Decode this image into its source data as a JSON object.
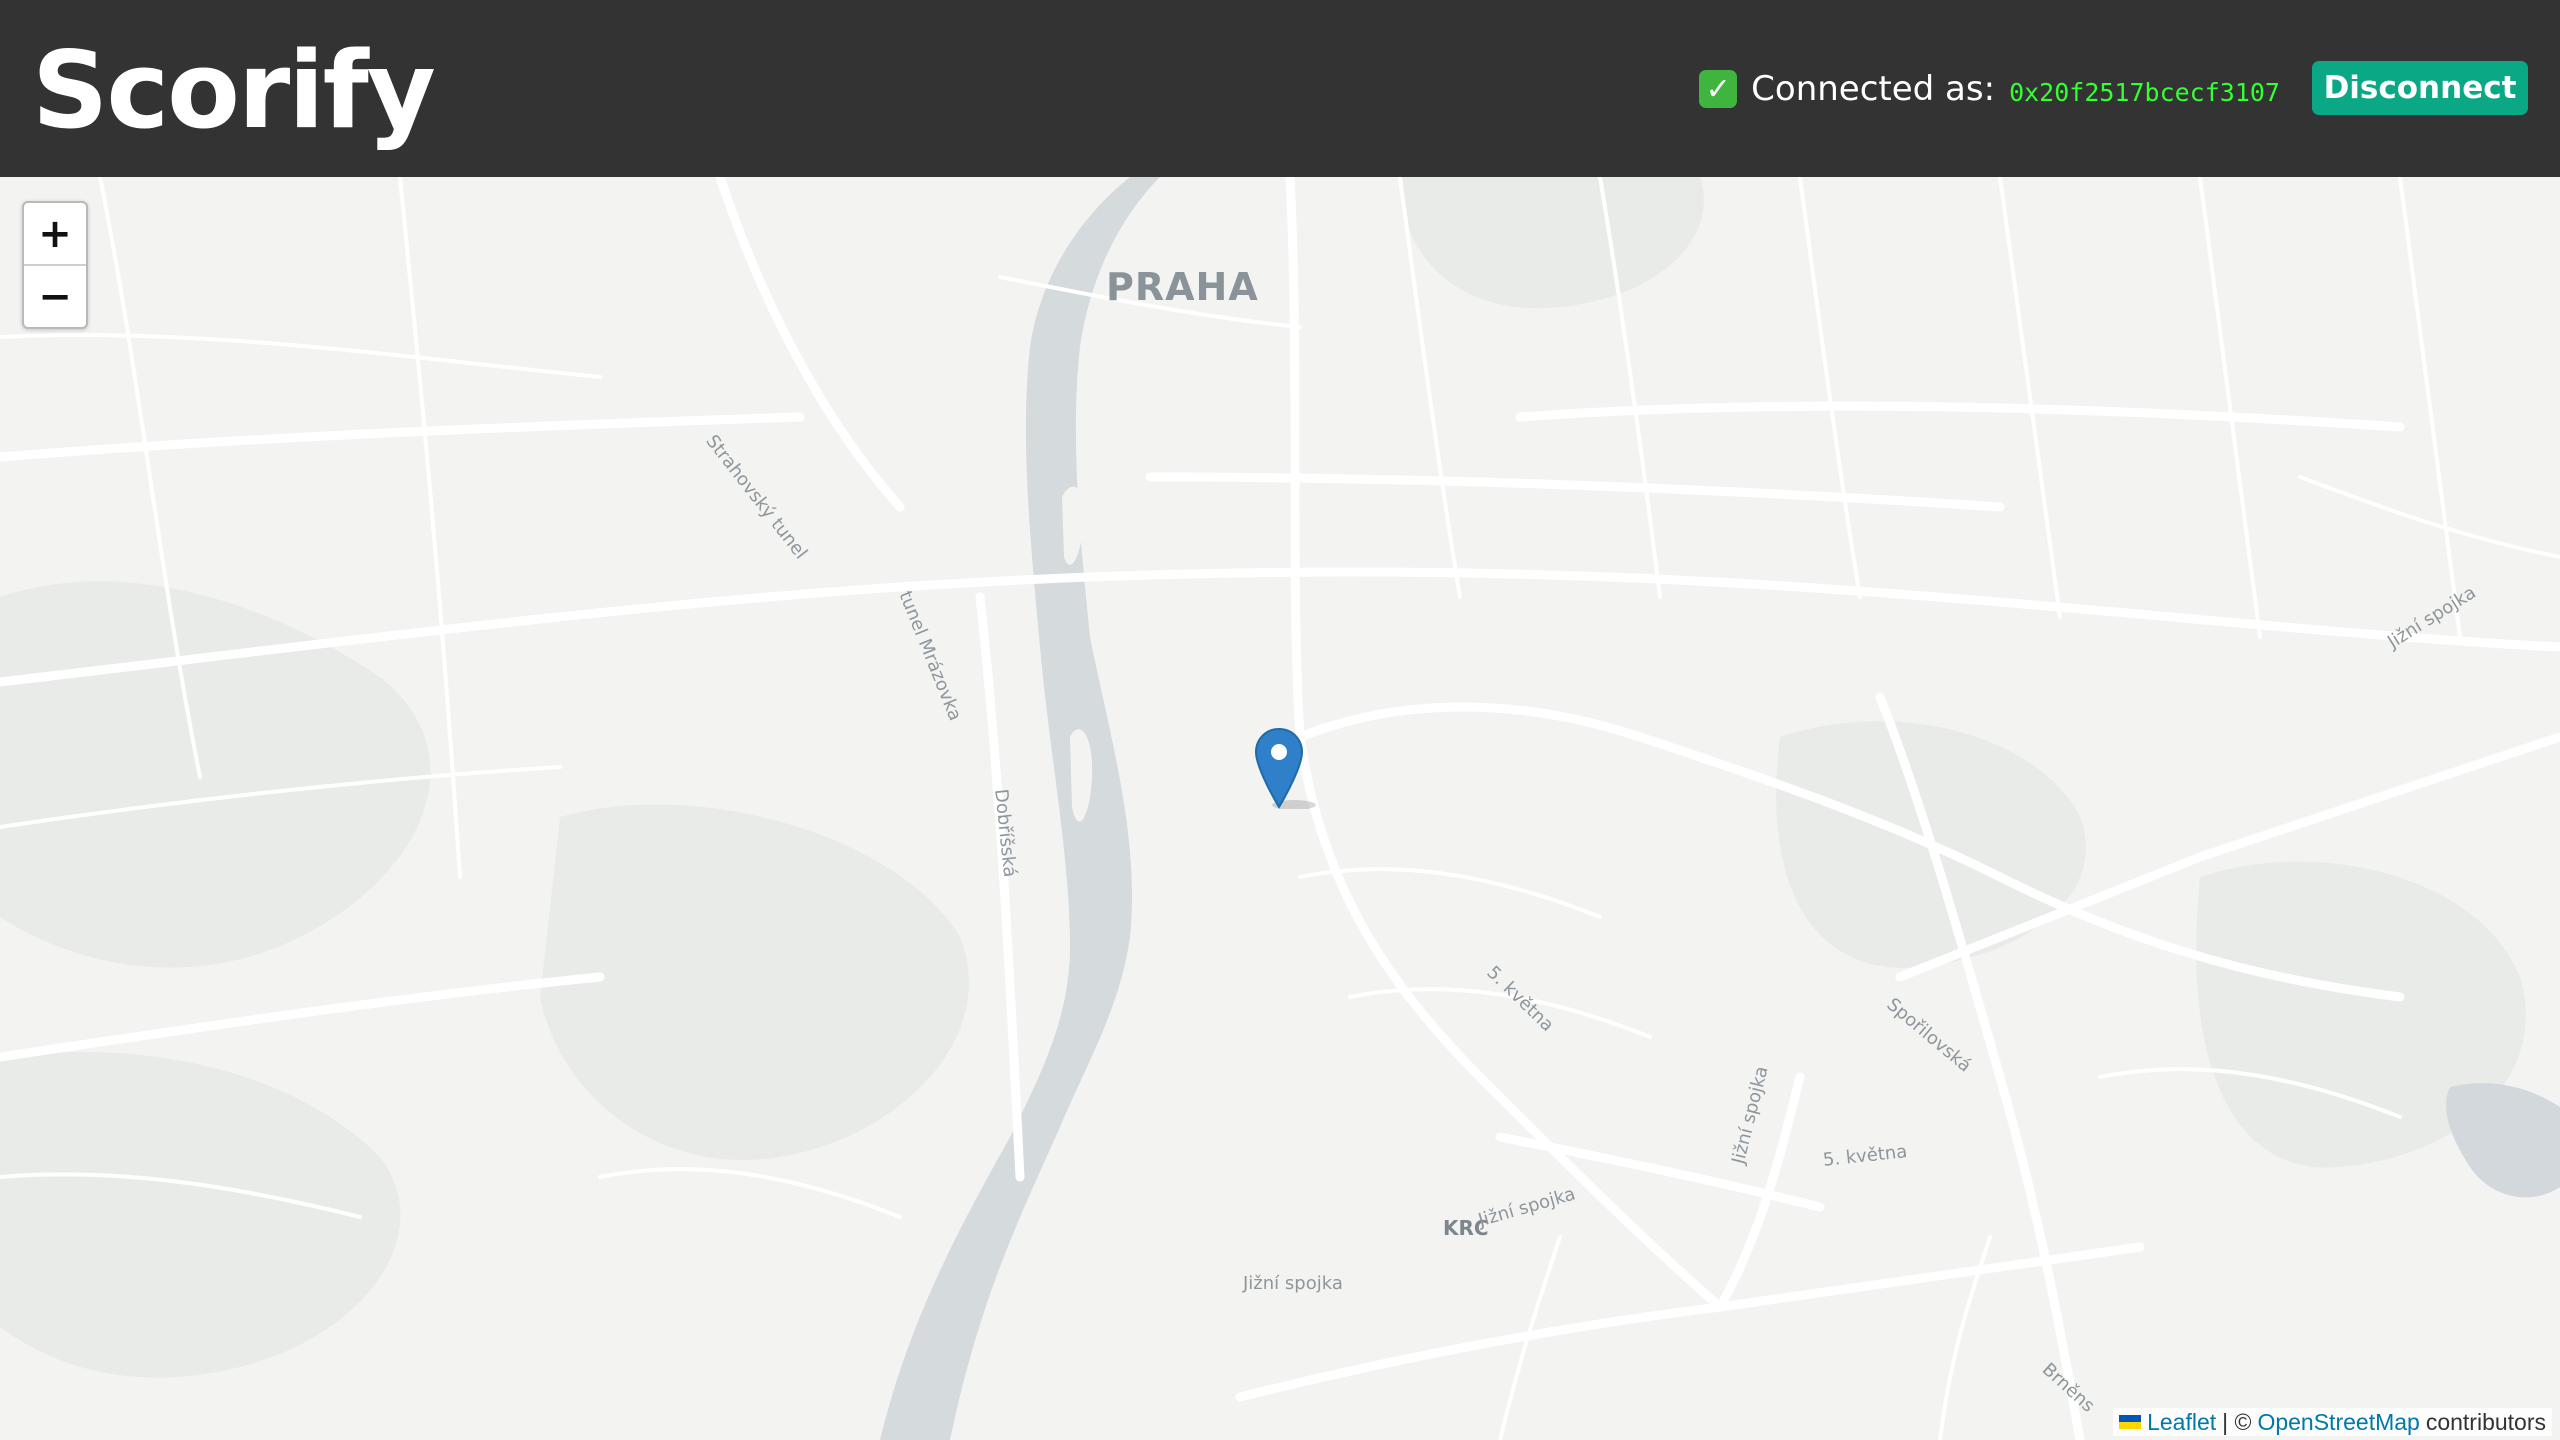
{
  "header": {
    "brand": "Scorify",
    "connected_label": "Connected as:",
    "check_icon": "white-check-mark-icon",
    "address": "0x20f2517bcecf3107",
    "disconnect_label": "Disconnect",
    "colors": {
      "bar": "#333333",
      "button": "#0aa884",
      "address": "#33ff33"
    }
  },
  "map": {
    "zoom_in": "+",
    "zoom_out": "−",
    "marker_icon": "blue-map-pin-icon",
    "labels": {
      "city": "PRAHA",
      "district": "KRC",
      "strahovsky": "Strahovský tunel",
      "mrazovka": "tunel Mrázovka",
      "dobrisska": "Dobříšská",
      "kvetna1": "5. května",
      "kvetna2": "5. května",
      "spojka1": "Jižní spojka",
      "spojka2": "Jižní spojka",
      "spojka3": "Jižní spojka",
      "spojka4": "Jižní spojka",
      "sporilovska": "Spořilovská",
      "brnenska": "Brněns"
    },
    "attribution": {
      "flag_icon": "ukraine-flag-icon",
      "leaflet": "Leaflet",
      "separator": "| ©",
      "osm": "OpenStreetMap",
      "contributors": "contributors"
    }
  }
}
